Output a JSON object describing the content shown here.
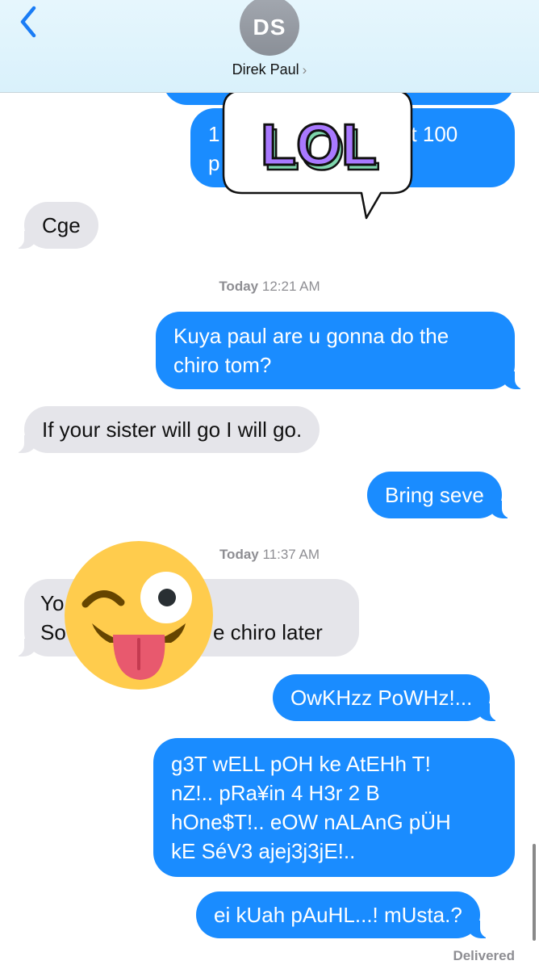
{
  "header": {
    "avatar_initials": "DS",
    "contact_name": "Direk Paul",
    "chevron": "›"
  },
  "stickers": {
    "lol_text": "LOL",
    "lol_colors": {
      "fill": "#a979ff",
      "shadow": "#7fd6ad",
      "outline": "#111111"
    },
    "emoji_name": "winking-face-with-tongue"
  },
  "messages": {
    "partial_top_out": "1                            ahit 100",
    "partial_top_out_line2": "p",
    "m_cge": "Cge",
    "ts1_day": "Today",
    "ts1_time": "12:21 AM",
    "m_kuya_line1": "Kuya paul are u gonna do the",
    "m_kuya_line2": "chiro tom?",
    "m_sister": "If your sister will go I will go.",
    "m_bring": "Bring seve",
    "ts2_day": "Today",
    "ts2_time": "11:37 AM",
    "m_yo_line1": "Yo",
    "m_yo_line2": "So",
    "m_yo_line2_end": "e chiro later",
    "m_owk": "OwKHzz PoWHz!...",
    "m_g3t_line1": "g3T wELL pOH ke AtEHh T!",
    "m_g3t_line2": "nZ!.. pRa¥in 4 H3r 2 B",
    "m_g3t_line3": "hOne$T!.. eOW nALAnG pÜH",
    "m_g3t_line4": "kE SéV3 ajej3j3jE!..",
    "m_ei": "ei kUah pAuHL...! mUsta.?",
    "delivered": "Delivered"
  },
  "colors": {
    "outgoing": "#1a8cff",
    "incoming": "#e5e5ea",
    "accent": "#1a7cf5"
  }
}
